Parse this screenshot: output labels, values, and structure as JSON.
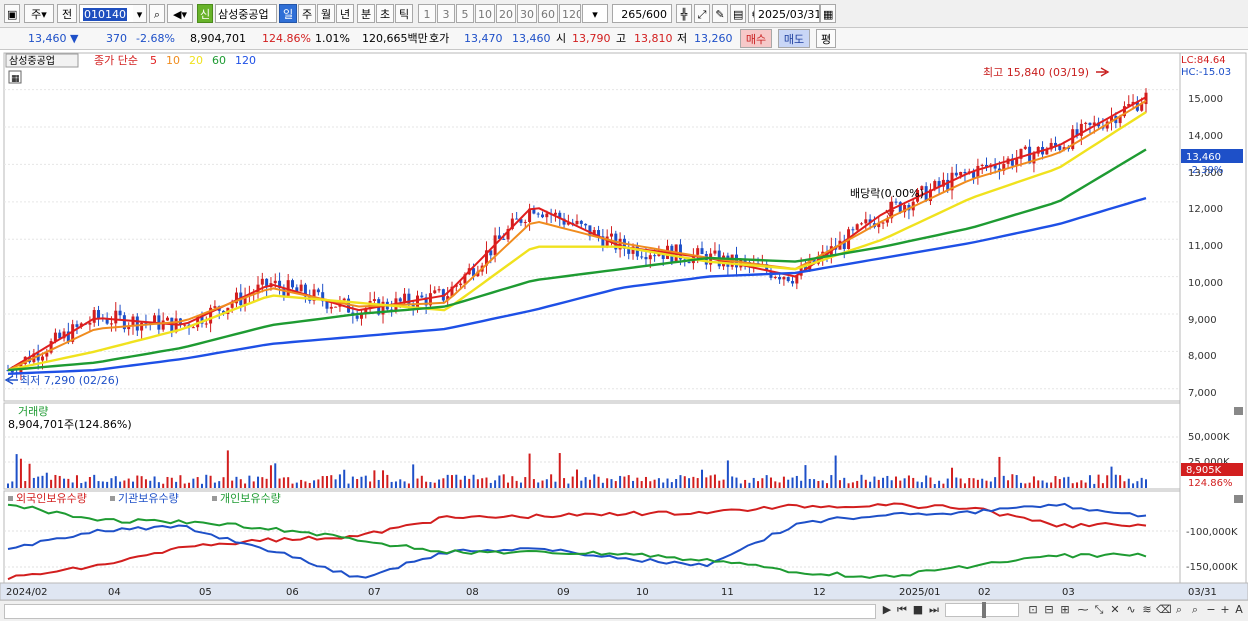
{
  "toolbar": {
    "market_type": "주",
    "period_type": "전",
    "code": "010140",
    "badge_new": "신",
    "stock_name": "삼성중공업",
    "tabs": [
      "일",
      "주",
      "월",
      "년",
      "분",
      "초",
      "틱"
    ],
    "active_tab": "일",
    "intervals": [
      "1",
      "3",
      "5",
      "10",
      "20",
      "30",
      "60",
      "120"
    ],
    "count_current": "265",
    "count_total": "/600",
    "date": "2025/03/31"
  },
  "quote": {
    "price": "13,460",
    "change": "370",
    "change_pct": "-2.68%",
    "volume": "8,904,701",
    "volume_ratio": "124.86%",
    "turnover": "1.01%",
    "amount": "120,665백만",
    "ask_label": "호가",
    "ask1": "13,470",
    "ask2": "13,460",
    "open_label": "시",
    "open": "13,790",
    "high_label": "고",
    "high": "13,810",
    "low_label": "저",
    "low": "13,260",
    "buy_label": "매수",
    "sell_label": "매도",
    "eval_label": "평"
  },
  "price_panel": {
    "stock_label": "삼성중공업",
    "legend_head": "종가 단순",
    "legend_ma": [
      {
        "label": "5",
        "color": "#e01e1e"
      },
      {
        "label": "10",
        "color": "#f08c1e"
      },
      {
        "label": "20",
        "color": "#f0e21e"
      },
      {
        "label": "60",
        "color": "#1e9b32"
      },
      {
        "label": "120",
        "color": "#1e50e6"
      }
    ],
    "y_ticks": [
      "15,000",
      "14,000",
      "13,000",
      "12,000",
      "11,000",
      "10,000",
      "9,000",
      "8,000",
      "7,000"
    ],
    "lc": "LC:84.64",
    "hc": "HC:-15.03",
    "current_price_box": "13,460",
    "current_pct": "-2.39%",
    "high_annotation": "최고 15,840 (03/19)",
    "low_annotation": "최저 7,290 (02/26)",
    "dividend_annotation": "배당락(0.00%)"
  },
  "volume_panel": {
    "title": "거래량",
    "value": "8,904,701주(124.86%)",
    "y_ticks": [
      "50,000K",
      "25,000K"
    ],
    "current_box": "8,905K",
    "current_pct": "124.86%"
  },
  "holdings_panel": {
    "legend": [
      {
        "label": "외국인보유수량",
        "color": "#d21e1e"
      },
      {
        "label": "기관보유수량",
        "color": "#1e50c8"
      },
      {
        "label": "개인보유수량",
        "color": "#1e9b32"
      }
    ],
    "y_ticks": [
      "-100,000K",
      "-150,000K"
    ]
  },
  "x_axis": {
    "labels": [
      "2024/02",
      "04",
      "05",
      "06",
      "07",
      "08",
      "09",
      "10",
      "11",
      "12",
      "2025/01",
      "02",
      "03"
    ],
    "right_label": "03/31"
  },
  "chart_data": {
    "type": "line",
    "x": [
      "2024-02",
      "2024-03",
      "2024-04",
      "2024-05",
      "2024-06",
      "2024-07",
      "2024-08",
      "2024-09",
      "2024-10",
      "2024-11",
      "2024-12",
      "2025-01",
      "2025-02",
      "2025-03"
    ],
    "series": [
      {
        "name": "5",
        "values": [
          7500,
          8900,
          8700,
          9800,
          9100,
          9500,
          11900,
          10800,
          10500,
          10000,
          11700,
          12800,
          13500,
          14800
        ]
      },
      {
        "name": "10",
        "values": [
          7500,
          8600,
          8800,
          9700,
          9200,
          9300,
          11500,
          10900,
          10500,
          10200,
          11500,
          12600,
          13300,
          14700
        ]
      },
      {
        "name": "20",
        "values": [
          7500,
          8000,
          8600,
          9500,
          9300,
          9100,
          10800,
          10800,
          10400,
          10200,
          11000,
          12100,
          12900,
          14400
        ]
      },
      {
        "name": "60",
        "values": [
          7500,
          7700,
          8100,
          8700,
          9000,
          9200,
          9900,
          10200,
          10500,
          10400,
          10800,
          11300,
          12000,
          13400
        ]
      },
      {
        "name": "120",
        "values": [
          7400,
          7500,
          7800,
          8200,
          8400,
          8600,
          9100,
          9700,
          10000,
          10100,
          10500,
          10900,
          11400,
          12100
        ]
      }
    ],
    "ylim": [
      6700,
      15900
    ],
    "grid": true,
    "legend": "top-left"
  }
}
